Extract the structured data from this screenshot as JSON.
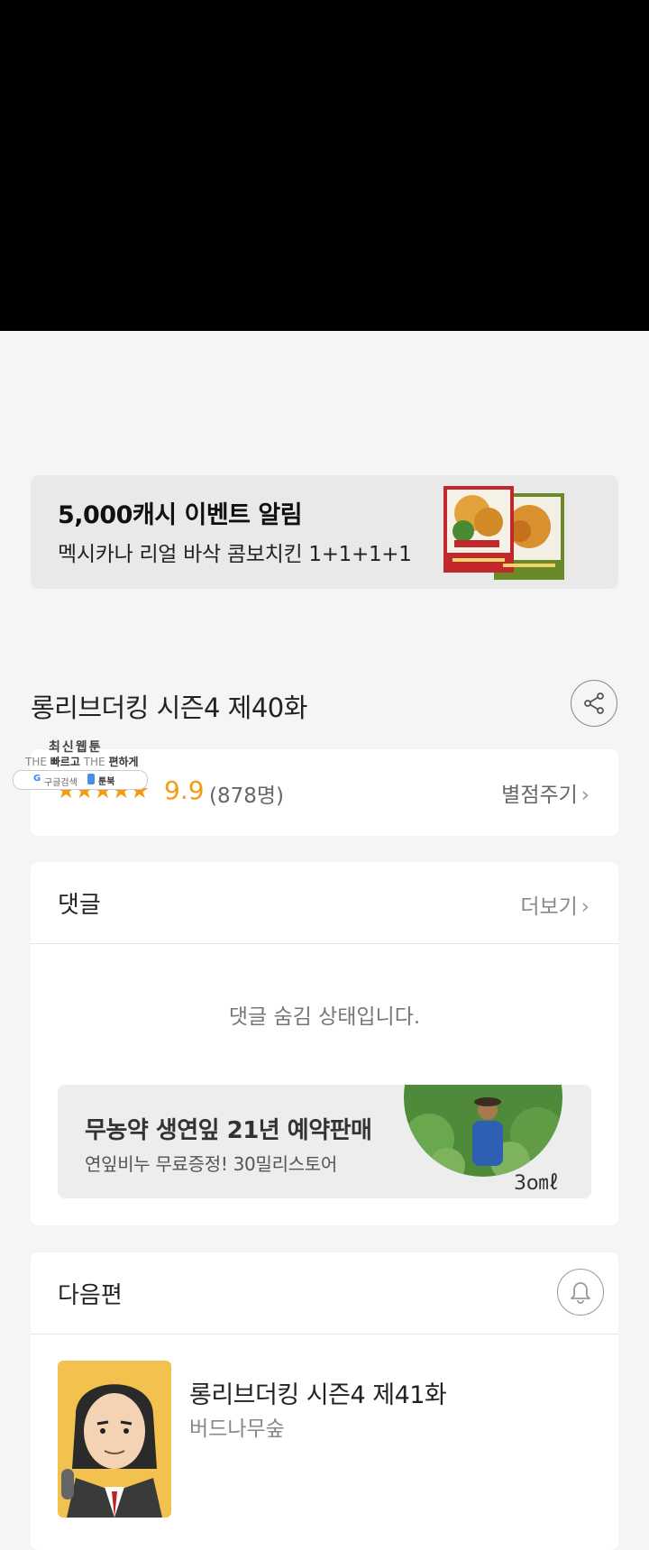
{
  "promo": {
    "title": "5,000캐시 이벤트 알림",
    "subtitle": "멕시카나 리얼 바삭 콤보치킨 1+1+1+1"
  },
  "episode": {
    "title": "롱리브더킹 시즌4 제40화"
  },
  "rating": {
    "stars": "★★★★★",
    "score": "9.9",
    "count": "(878명)",
    "rate_label": "별점주기",
    "chevron": "›"
  },
  "watermark": {
    "line1": "최신웹툰",
    "line2_a": "THE ",
    "line2_b": "빠르고",
    "line2_c": " THE ",
    "line2_d": "편하게",
    "pill_g": "G",
    "pill_search": "구글검색",
    "pill_brand": "툰북"
  },
  "comments": {
    "title": "댓글",
    "more_label": "더보기",
    "chevron": "›",
    "hidden_message": "댓글 숨김 상태입니다."
  },
  "ad": {
    "title": "무농약 생연잎 21년 예약판매",
    "subtitle": "연잎비누 무료증정! 30밀리스토어",
    "brand": "3o㎖"
  },
  "next": {
    "header": "다음편",
    "title": "롱리브더킹 시즌4 제41화",
    "author": "버드나무숲"
  }
}
